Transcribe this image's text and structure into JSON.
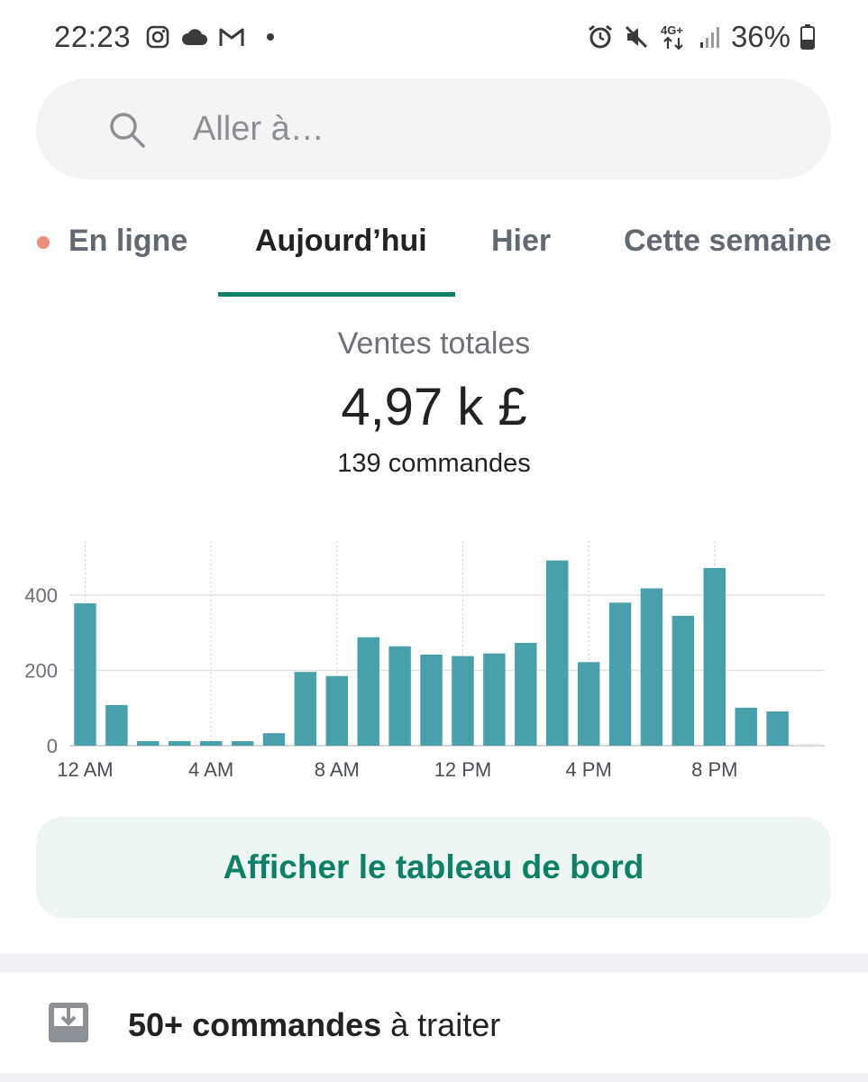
{
  "status_bar": {
    "time": "22:23",
    "left_icons": [
      "instagram-icon",
      "cloud-icon",
      "gmail-icon",
      "dot-icon"
    ],
    "right_icons": [
      "alarm-icon",
      "mute-icon",
      "4g-plus-icon",
      "signal-icon",
      "battery-icon"
    ],
    "network_label": "4G+",
    "battery_percent": "36%"
  },
  "search": {
    "placeholder": "Aller à…"
  },
  "tabs": [
    {
      "label": "En ligne",
      "active": false,
      "indicator_color": "#ed8d7c"
    },
    {
      "label": "Aujourd’hui",
      "active": true
    },
    {
      "label": "Hier",
      "active": false
    },
    {
      "label": "Cette semaine",
      "active": false
    }
  ],
  "summary": {
    "label": "Ventes totales",
    "value": "4,97 k £",
    "orders": "139 commandes"
  },
  "chart_data": {
    "type": "bar",
    "categories": [
      "12 AM",
      "1 AM",
      "2 AM",
      "3 AM",
      "4 AM",
      "5 AM",
      "6 AM",
      "7 AM",
      "8 AM",
      "9 AM",
      "10 AM",
      "11 AM",
      "12 PM",
      "1 PM",
      "2 PM",
      "3 PM",
      "4 PM",
      "5 PM",
      "6 PM",
      "7 PM",
      "8 PM",
      "9 PM",
      "10 PM",
      "11 PM"
    ],
    "values": [
      378,
      108,
      12,
      12,
      12,
      12,
      33,
      196,
      185,
      288,
      264,
      242,
      238,
      245,
      273,
      492,
      222,
      380,
      418,
      345,
      472,
      101,
      91,
      5
    ],
    "xtick_labels": [
      "12 AM",
      "4 AM",
      "8 AM",
      "12 PM",
      "4 PM",
      "8 PM"
    ],
    "ytick_labels": [
      "0",
      "200",
      "400"
    ],
    "ylim": [
      0,
      540
    ],
    "color": "#47a0aa",
    "grid": true,
    "title": "",
    "xlabel": "",
    "ylabel": ""
  },
  "dashboard_button": {
    "label": "Afficher le tableau de bord"
  },
  "orders_to_process": {
    "count_label": "50+ commandes",
    "suffix": " à traiter"
  },
  "colors": {
    "accent": "#0e8067",
    "bar": "#47a0aa",
    "search_bg": "#f4f4f5"
  }
}
